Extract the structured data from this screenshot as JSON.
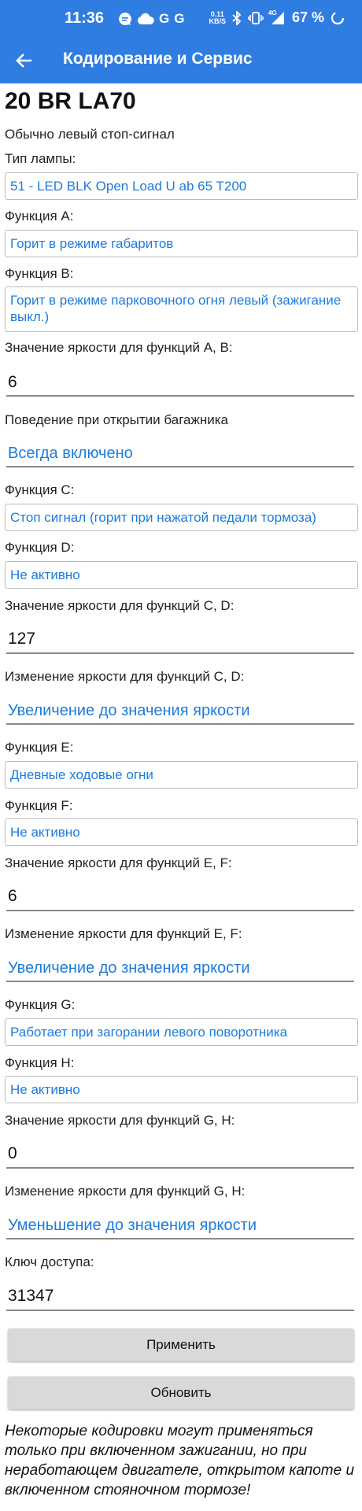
{
  "status": {
    "time": "11:36",
    "net_speed_value": "0.11",
    "net_speed_unit": "KB/S",
    "network": "4G",
    "battery": "67 %",
    "icons": [
      "chat-icon",
      "cloud-icon",
      "google-icon",
      "google-icon",
      "network-speed-icon",
      "bluetooth-icon",
      "vibrate-icon",
      "signal-icon",
      "battery-saver-icon"
    ]
  },
  "appbar": {
    "title": "Кодирование и Сервис"
  },
  "page": {
    "heading": "20 BR LA70",
    "subtitle": "Обычно левый стоп-сигнал",
    "lamp_type_label": "Тип лампы:",
    "lamp_type_value": "51 - LED BLK Open Load U ab 65 T200",
    "func_a_label": "Функция A:",
    "func_a_value": "Горит в режиме габаритов",
    "func_b_label": "Функция B:",
    "func_b_value": "Горит в режиме парковочного огня левый (зажигание выкл.)",
    "brightness_ab_label": "Значение яркости для функций A, B:",
    "brightness_ab_value": "6",
    "trunk_label": "Поведение при открытии багажника",
    "trunk_value": "Всегда включено",
    "func_c_label": "Функция C:",
    "func_c_value": "Стоп сигнал (горит при нажатой педали тормоза)",
    "func_d_label": "Функция D:",
    "func_d_value": "Не активно",
    "brightness_cd_label": "Значение яркости для функций C, D:",
    "brightness_cd_value": "127",
    "change_cd_label": "Изменение яркости для функций C, D:",
    "change_cd_value": "Увеличение до значения яркости",
    "func_e_label": "Функция E:",
    "func_e_value": "Дневные ходовые огни",
    "func_f_label": "Функция F:",
    "func_f_value": "Не активно",
    "brightness_ef_label": "Значение яркости для функций E, F:",
    "brightness_ef_value": "6",
    "change_ef_label": "Изменение яркости для функций E, F:",
    "change_ef_value": "Увеличение до значения яркости",
    "func_g_label": "Функция G:",
    "func_g_value": "Работает при загорании левого поворотника",
    "func_h_label": "Функция H:",
    "func_h_value": "Не активно",
    "brightness_gh_label": "Значение яркости для функций G, H:",
    "brightness_gh_value": "0",
    "change_gh_label": "Изменение яркости для функций G, H:",
    "change_gh_value": "Уменьшение до значения яркости",
    "access_key_label": "Ключ доступа:",
    "access_key_value": "31347",
    "apply_button": "Применить",
    "refresh_button": "Обновить",
    "note": "Некоторые кодировки могут применяться только при включенном зажигании, но при неработающем двигателе, открытом капоте и включенном стояночном тормозе!"
  },
  "colors": {
    "accent": "#2f7de1",
    "value_text": "#1e7bd9",
    "button": "#d9d9d9"
  }
}
